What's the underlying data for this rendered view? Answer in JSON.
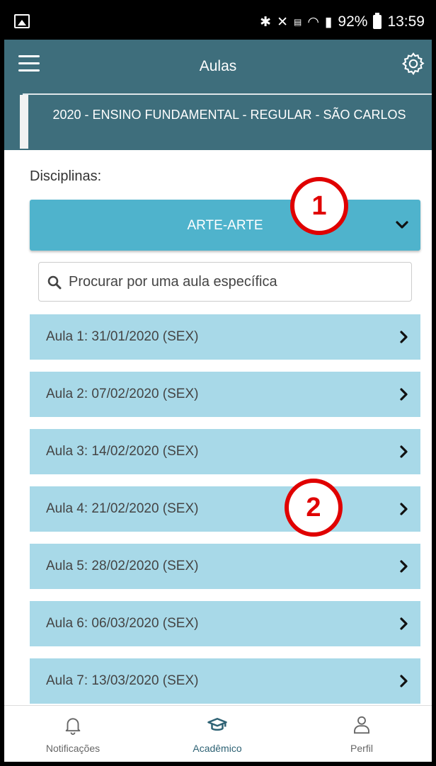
{
  "status_bar": {
    "battery": "92%",
    "time": "13:59",
    "icons": [
      "bluetooth-icon",
      "mute-icon",
      "volte-icon",
      "wifi-icon",
      "signal-icon"
    ]
  },
  "header": {
    "title": "Aulas"
  },
  "banner": {
    "text": "2020 - ENSINO FUNDAMENTAL - REGULAR - SÃO CARLOS"
  },
  "disciplines": {
    "label": "Disciplinas:",
    "selected": "ARTE-ARTE"
  },
  "search": {
    "placeholder": "Procurar por uma aula específica"
  },
  "lessons": [
    {
      "label": "Aula 1: 31/01/2020 (SEX)"
    },
    {
      "label": "Aula 2: 07/02/2020 (SEX)"
    },
    {
      "label": "Aula 3: 14/02/2020 (SEX)"
    },
    {
      "label": "Aula 4: 21/02/2020 (SEX)"
    },
    {
      "label": "Aula 5: 28/02/2020 (SEX)"
    },
    {
      "label": "Aula 6: 06/03/2020 (SEX)"
    },
    {
      "label": "Aula 7: 13/03/2020 (SEX)"
    }
  ],
  "annotations": {
    "marker1": "1",
    "marker2": "2"
  },
  "bottom_nav": {
    "items": [
      {
        "label": "Notificações",
        "icon": "bell-icon"
      },
      {
        "label": "Acadêmico",
        "icon": "graduation-cap-icon",
        "active": true
      },
      {
        "label": "Perfil",
        "icon": "user-icon"
      }
    ]
  },
  "colors": {
    "header": "#3e6e7c",
    "dropdown": "#4fb3cc",
    "list_item": "#a8d9e8",
    "annotation": "#e00000"
  }
}
